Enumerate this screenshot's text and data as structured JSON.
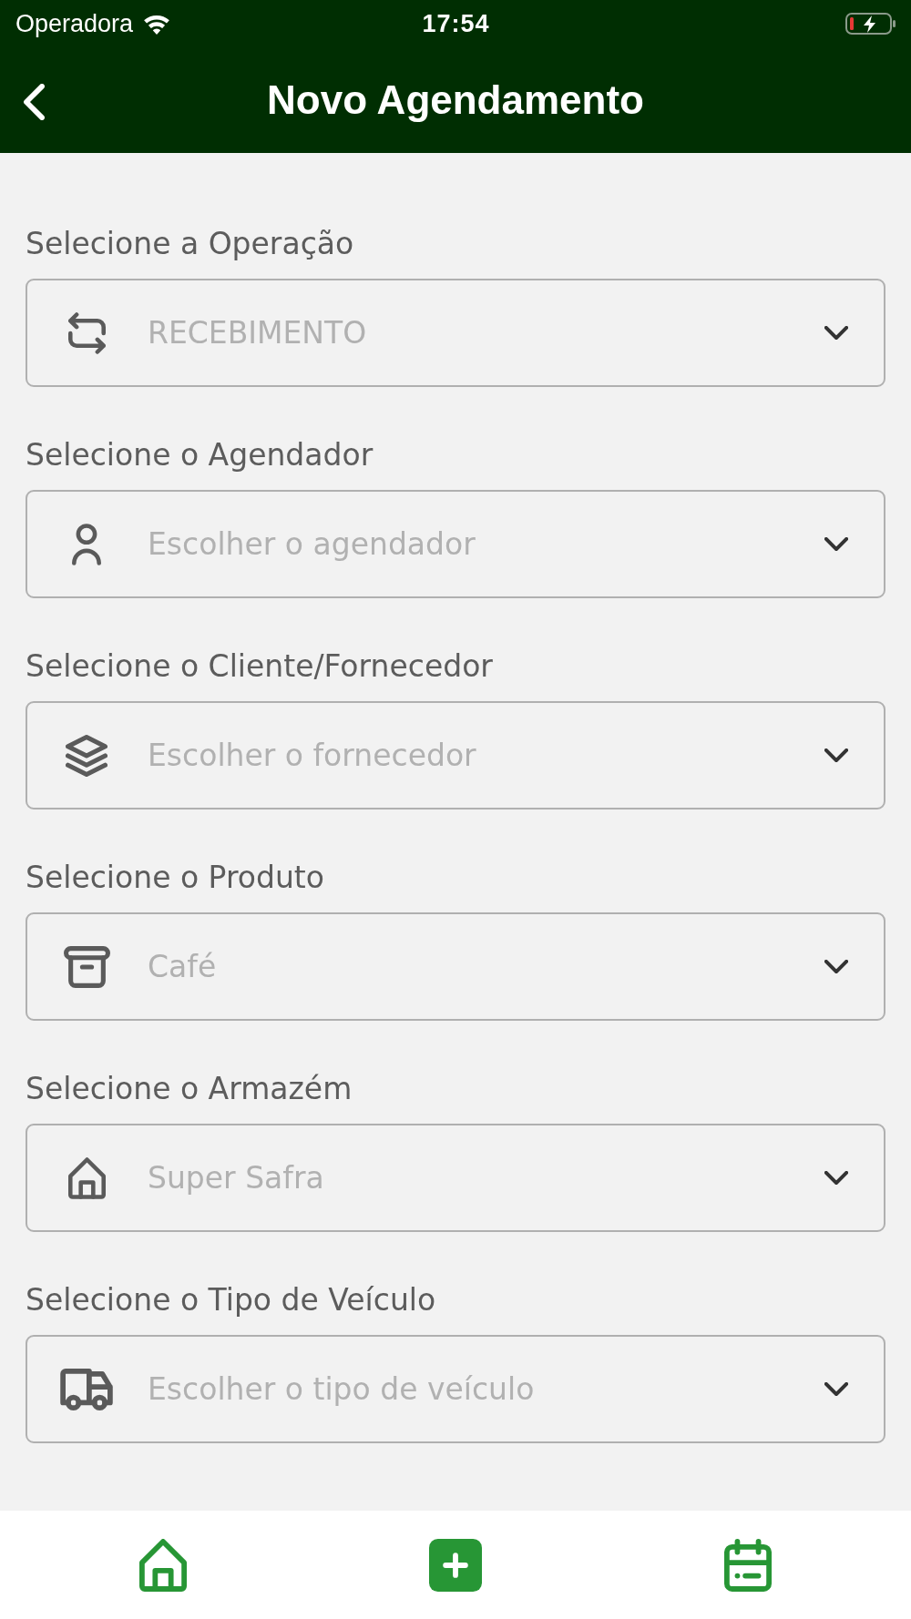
{
  "status_bar": {
    "carrier": "Operadora",
    "time": "17:54"
  },
  "header": {
    "title": "Novo Agendamento"
  },
  "fields": [
    {
      "label": "Selecione a Operação",
      "value": "RECEBIMENTO"
    },
    {
      "label": "Selecione o Agendador",
      "placeholder": "Escolher o agendador"
    },
    {
      "label": "Selecione o Cliente/Fornecedor",
      "placeholder": "Escolher o fornecedor"
    },
    {
      "label": "Selecione o Produto",
      "value": "Café"
    },
    {
      "label": "Selecione o Armazém",
      "value": "Super Safra"
    },
    {
      "label": "Selecione o Tipo de Veículo",
      "placeholder": "Escolher o tipo de veículo"
    }
  ]
}
